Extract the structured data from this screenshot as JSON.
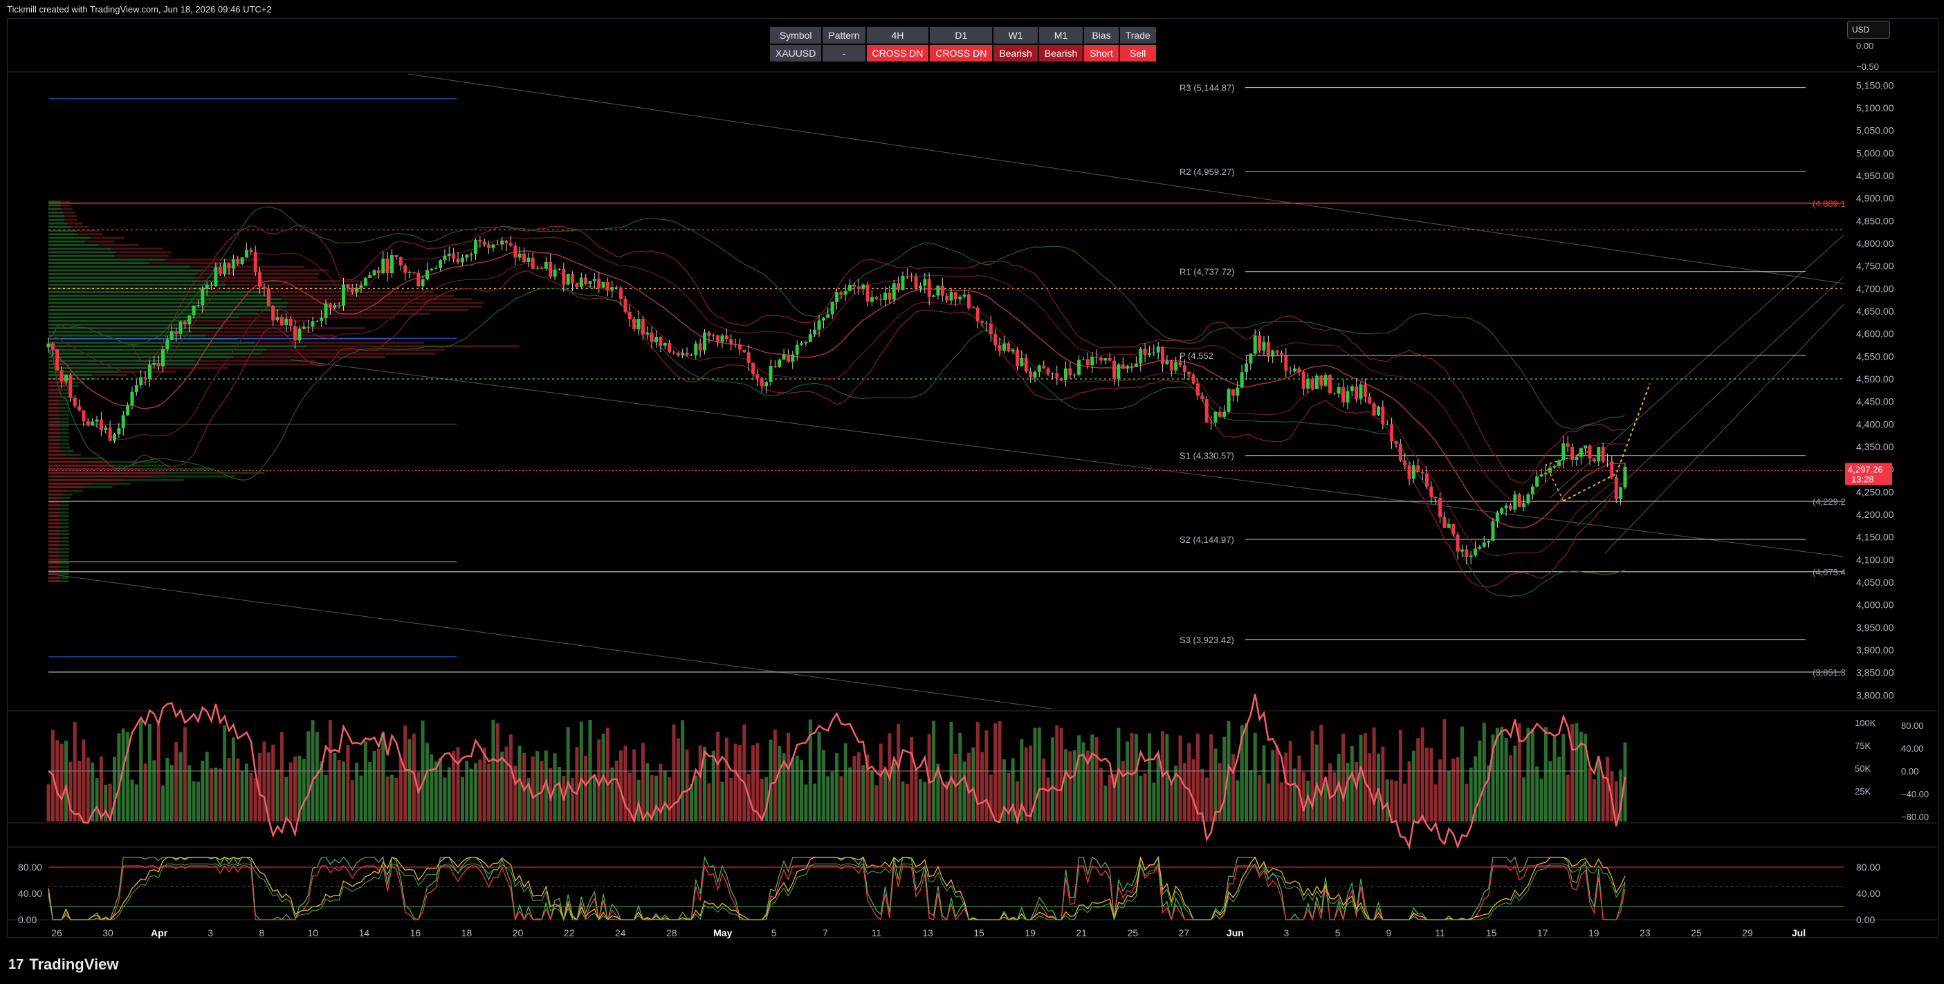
{
  "header": {
    "attribution": "Tickmill created with TradingView.com, Jun 18, 2026 09:46 UTC+2"
  },
  "footer": {
    "brand": "TradingView",
    "logo_glyph": "17"
  },
  "currency_selector": {
    "value": "USD"
  },
  "signal_table": {
    "headers": [
      "Symbol",
      "Pattern",
      "4H",
      "D1",
      "W1",
      "M1",
      "Bias",
      "Trade"
    ],
    "row": [
      {
        "text": "XAUUSD",
        "style": "sym"
      },
      {
        "text": "-",
        "style": "neu"
      },
      {
        "text": "CROSS DN",
        "style": "red"
      },
      {
        "text": "CROSS DN",
        "style": "red"
      },
      {
        "text": "Bearish",
        "style": "dred"
      },
      {
        "text": "Bearish",
        "style": "dred"
      },
      {
        "text": "Short",
        "style": "red"
      },
      {
        "text": "Sell",
        "style": "red"
      }
    ]
  },
  "chart_data": [
    {
      "type": "candlestick",
      "symbol": "XAUUSD",
      "ylim": [
        3770,
        5175
      ],
      "y_ticks": [
        "5,150.00",
        "5,100.00",
        "5,050.00",
        "5,000.00",
        "4,950.00",
        "4,900.00",
        "4,850.00",
        "4,800.00",
        "4,750.00",
        "4,700.00",
        "4,650.00",
        "4,600.00",
        "4,550.00",
        "4,500.00",
        "4,450.00",
        "4,400.00",
        "4,350.00",
        "4,300.00",
        "4,250.00",
        "4,200.00",
        "4,150.00",
        "4,100.00",
        "4,050.00",
        "4,000.00",
        "3,950.00",
        "3,900.00",
        "3,850.00",
        "3,800.00"
      ],
      "top_pane_ticks": [
        "0.00",
        "−0.50"
      ],
      "x_ticks": [
        "26",
        "30",
        "Apr",
        "3",
        "8",
        "10",
        "14",
        "16",
        "18",
        "20",
        "22",
        "24",
        "28",
        "May",
        "5",
        "7",
        "11",
        "13",
        "15",
        "19",
        "21",
        "25",
        "27",
        "Jun",
        "3",
        "5",
        "9",
        "11",
        "15",
        "17",
        "19",
        "23",
        "25",
        "29",
        "Jul"
      ],
      "x_tick_bold": [
        "Apr",
        "May",
        "Jun",
        "Jul"
      ],
      "pivot_levels": [
        {
          "label": "R3 (5,144.87)",
          "value": 5144.87
        },
        {
          "label": "R2 (4,959.27)",
          "value": 4959.27
        },
        {
          "label": "R1 (4,737.72)",
          "value": 4737.72
        },
        {
          "label": "P (4,552",
          "value": 4552
        },
        {
          "label": "S1 (4,330.57)",
          "value": 4330.57
        },
        {
          "label": "S2 (4,144.97)",
          "value": 4144.97
        },
        {
          "label": "S3 (3,923.42)",
          "value": 3923.42
        }
      ],
      "horizontal_levels": [
        {
          "label": "(4,889.1",
          "value": 4889.1,
          "color": "#f23645"
        },
        {
          "label": "(4,229.2",
          "value": 4229.2,
          "color": "#9598a1"
        },
        {
          "label": "(4,073.4",
          "value": 4073.4,
          "color": "#9598a1"
        },
        {
          "label": "(3,851.3",
          "value": 3851.3,
          "color": "#9598a1"
        }
      ],
      "current_price": {
        "value": "4,297.26",
        "countdown": "13:28",
        "color": "#f23645"
      },
      "price_path": [
        [
          0,
          4570
        ],
        [
          8,
          4420
        ],
        [
          14,
          4380
        ],
        [
          22,
          4500
        ],
        [
          30,
          4620
        ],
        [
          40,
          4760
        ],
        [
          46,
          4780
        ],
        [
          50,
          4650
        ],
        [
          56,
          4600
        ],
        [
          62,
          4640
        ],
        [
          68,
          4700
        ],
        [
          78,
          4760
        ],
        [
          84,
          4720
        ],
        [
          90,
          4780
        ],
        [
          95,
          4760
        ],
        [
          98,
          4820
        ],
        [
          104,
          4790
        ],
        [
          110,
          4750
        ],
        [
          116,
          4730
        ],
        [
          122,
          4720
        ],
        [
          128,
          4700
        ],
        [
          132,
          4640
        ],
        [
          140,
          4560
        ],
        [
          146,
          4570
        ],
        [
          152,
          4600
        ],
        [
          156,
          4560
        ],
        [
          162,
          4500
        ],
        [
          168,
          4550
        ],
        [
          174,
          4620
        ],
        [
          180,
          4700
        ],
        [
          186,
          4690
        ],
        [
          190,
          4680
        ],
        [
          194,
          4720
        ],
        [
          200,
          4700
        ],
        [
          208,
          4680
        ],
        [
          214,
          4600
        ],
        [
          222,
          4520
        ],
        [
          230,
          4500
        ],
        [
          236,
          4540
        ],
        [
          242,
          4520
        ],
        [
          248,
          4560
        ],
        [
          254,
          4550
        ],
        [
          260,
          4480
        ],
        [
          264,
          4400
        ],
        [
          270,
          4490
        ],
        [
          274,
          4580
        ],
        [
          280,
          4540
        ],
        [
          284,
          4500
        ],
        [
          290,
          4490
        ],
        [
          294,
          4460
        ],
        [
          298,
          4470
        ],
        [
          304,
          4400
        ],
        [
          308,
          4300
        ],
        [
          312,
          4280
        ],
        [
          316,
          4200
        ],
        [
          322,
          4100
        ],
        [
          326,
          4130
        ],
        [
          330,
          4210
        ],
        [
          336,
          4250
        ],
        [
          340,
          4310
        ],
        [
          344,
          4340
        ],
        [
          348,
          4340
        ],
        [
          354,
          4330
        ],
        [
          356,
          4240
        ],
        [
          358,
          4297
        ]
      ],
      "volume_axis": [
        "100K",
        "75K",
        "50K",
        "25K"
      ],
      "oscillator_axis": [
        "80.00",
        "40.00",
        "0.00",
        "−40.00",
        "−80.00"
      ]
    },
    {
      "type": "line",
      "name": "stochastic",
      "ylim": [
        0,
        100
      ],
      "y_ticks": [
        "80.00",
        "40.00",
        "0.00"
      ]
    }
  ]
}
